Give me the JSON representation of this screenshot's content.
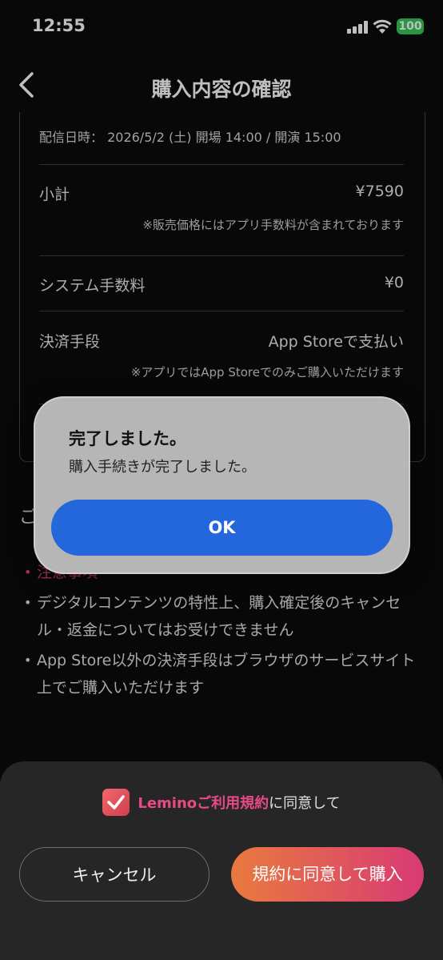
{
  "status_bar": {
    "time": "12:55",
    "battery": "100",
    "battery_color": "#34c759"
  },
  "header": {
    "title": "購入内容の確認"
  },
  "summary": {
    "date_text": "配信日時： 2026/5/2 (土) 開場 14:00 / 開演 15:00",
    "subtotal_label": "小計",
    "subtotal_value": "¥7590",
    "subtotal_note": "※販売価格にはアプリ手数料が含まれております",
    "fee_label": "システム手数料",
    "fee_value": "¥0",
    "payment_label": "決済手段",
    "payment_value": "App Storeで支払い",
    "payment_note": "※アプリではApp Storeでのみご購入いただけます"
  },
  "notes": {
    "title": "ご",
    "items": [
      "注意事項",
      "デジタルコンテンツの特性上、購入確定後のキャンセル・返金についてはお受けできません",
      "App Store以外の決済手段はブラウザのサービスサイト上でご購入いただけます"
    ]
  },
  "alert": {
    "title": "完了しました。",
    "message": "購入手続きが完了しました。",
    "ok_label": "OK",
    "ok_color": "#2466dc"
  },
  "footer": {
    "checked": true,
    "terms_link": "Leminoご利用規約",
    "terms_suffix": "に同意して",
    "cancel_label": "キャンセル",
    "purchase_label": "規約に同意して購入",
    "accent": "#e84a86"
  }
}
